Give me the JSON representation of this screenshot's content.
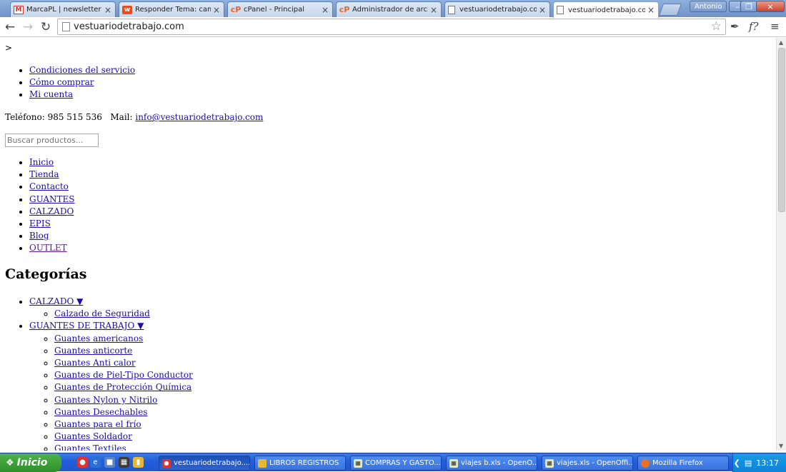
{
  "browser": {
    "tabs": [
      {
        "label": "MarcaPL | newsletter - Ba",
        "icon": "gmail-icon"
      },
      {
        "label": "Responder Tema: cambio",
        "icon": "forum-icon"
      },
      {
        "label": "cPanel - Principal",
        "icon": "cpanel-icon"
      },
      {
        "label": "Administrador de archivos",
        "icon": "cpanel-icon"
      },
      {
        "label": "vestuariodetrabajo.com/",
        "icon": "page-icon"
      },
      {
        "label": "vestuariodetrabajo.com",
        "icon": "page-icon",
        "active": true
      }
    ],
    "close_glyph": "×",
    "user_name": "Antonio",
    "window_controls": {
      "minimize": "–",
      "maximize": "❐",
      "close": "×"
    },
    "url": "vestuariodetrabajo.com"
  },
  "page": {
    "stray_text": ">",
    "top_links": [
      "Condiciones del servicio",
      "Cómo comprar",
      "Mi cuenta"
    ],
    "phone_text": "Teléfono: 985 515 536   Mail: ",
    "mail_link": "info@vestuariodetrabajo.com",
    "search_placeholder": "Buscar productos...",
    "main_nav": [
      "Inicio",
      "Tienda",
      "Contacto",
      "GUANTES",
      "CALZADO",
      "EPIS",
      "Blog",
      "OUTLET"
    ],
    "categories_title": "Categorías",
    "categories": {
      "cat1": {
        "label": "CALZADO ▼",
        "subs": [
          "Calzado de Seguridad"
        ]
      },
      "cat2": {
        "label": "GUANTES DE TRABAJO ▼",
        "subs": [
          "Guantes americanos",
          "Guantes anticorte",
          "Guantes Anti calor",
          "Guantes de Piel-Tipo Conductor",
          "Guantes de Protección Química",
          "Guantes Nylon y Nitrilo",
          "Guantes Desechables",
          "Guantes para el frío",
          "Guantes Soldador",
          "Guantes Textiles"
        ]
      }
    }
  },
  "taskbar": {
    "start_label": "Inicio",
    "items": [
      {
        "label": "vestuariodetrabajo....",
        "icon": "chrome-icon",
        "active": true
      },
      {
        "label": "LIBROS REGISTROS",
        "icon": "folder-icon"
      },
      {
        "label": "COMPRAS Y GASTO...",
        "icon": "spreadsheet-icon"
      },
      {
        "label": "viajes b.xls - OpenO...",
        "icon": "spreadsheet-icon"
      },
      {
        "label": "viajes.xls - OpenOffi...",
        "icon": "spreadsheet-icon"
      },
      {
        "label": "Mozilla Firefox",
        "icon": "firefox-icon"
      }
    ],
    "clock": "13:17"
  }
}
